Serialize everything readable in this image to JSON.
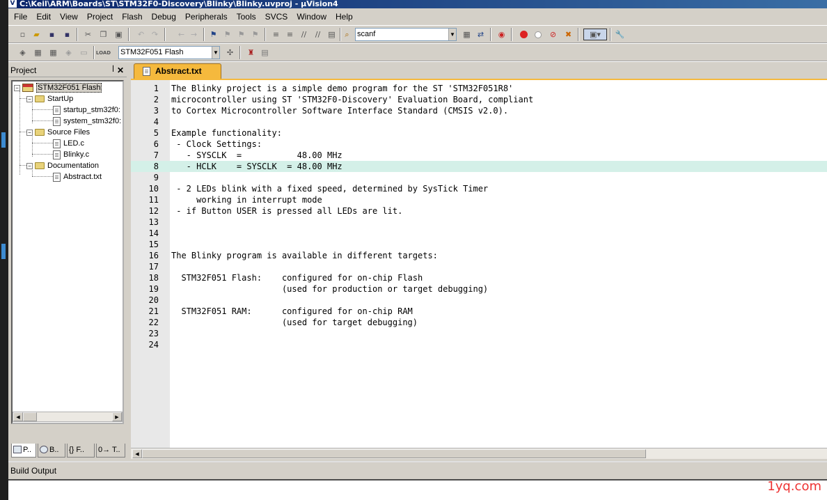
{
  "window": {
    "title": "C:\\Keil\\ARM\\Boards\\ST\\STM32F0-Discovery\\Blinky\\Blinky.uvproj - µVision4"
  },
  "menu": [
    "File",
    "Edit",
    "View",
    "Project",
    "Flash",
    "Debug",
    "Peripherals",
    "Tools",
    "SVCS",
    "Window",
    "Help"
  ],
  "toolbar": {
    "find_value": "scanf",
    "target_value": "STM32F051 Flash"
  },
  "project_pane": {
    "title": "Project",
    "tree": {
      "target": "STM32F051 Flash",
      "groups": [
        {
          "name": "StartUp",
          "files": [
            "startup_stm32f0:",
            "system_stm32f0:"
          ]
        },
        {
          "name": "Source Files",
          "files": [
            "LED.c",
            "Blinky.c"
          ]
        },
        {
          "name": "Documentation",
          "files": [
            "Abstract.txt"
          ]
        }
      ]
    },
    "tabs": [
      "P..",
      "B..",
      "{} F..",
      "0→ T.."
    ]
  },
  "editor": {
    "tab_title": "Abstract.txt",
    "highlighted_line": 8,
    "lines": [
      {
        "n": "1",
        "t": "The Blinky project is a simple demo program for the ST 'STM32F051R8'"
      },
      {
        "n": "2",
        "t": "microcontroller using ST 'STM32F0-Discovery' Evaluation Board, compliant"
      },
      {
        "n": "3",
        "t": "to Cortex Microcontroller Software Interface Standard (CMSIS v2.0)."
      },
      {
        "n": "4",
        "t": ""
      },
      {
        "n": "5",
        "t": "Example functionality:"
      },
      {
        "n": "6",
        "t": " - Clock Settings:"
      },
      {
        "n": "7",
        "t": "   - SYSCLK  =           48.00 MHz"
      },
      {
        "n": "8",
        "t": "   - HCLK    = SYSCLK  = 48.00 MHz"
      },
      {
        "n": "9",
        "t": ""
      },
      {
        "n": "10",
        "t": " - 2 LEDs blink with a fixed speed, determined by SysTick Timer"
      },
      {
        "n": "11",
        "t": "     working in interrupt mode"
      },
      {
        "n": "12",
        "t": " - if Button USER is pressed all LEDs are lit."
      },
      {
        "n": "13",
        "t": ""
      },
      {
        "n": "14",
        "t": ""
      },
      {
        "n": "15",
        "t": ""
      },
      {
        "n": "16",
        "t": "The Blinky program is available in different targets:"
      },
      {
        "n": "17",
        "t": ""
      },
      {
        "n": "18",
        "t": "  STM32F051 Flash:    configured for on-chip Flash"
      },
      {
        "n": "19",
        "t": "                      (used for production or target debugging)"
      },
      {
        "n": "20",
        "t": ""
      },
      {
        "n": "21",
        "t": "  STM32F051 RAM:      configured for on-chip RAM"
      },
      {
        "n": "22",
        "t": "                      (used for target debugging)"
      },
      {
        "n": "23",
        "t": ""
      },
      {
        "n": "24",
        "t": ""
      }
    ]
  },
  "build_output": {
    "title": "Build Output"
  },
  "watermark": "1yq.com"
}
